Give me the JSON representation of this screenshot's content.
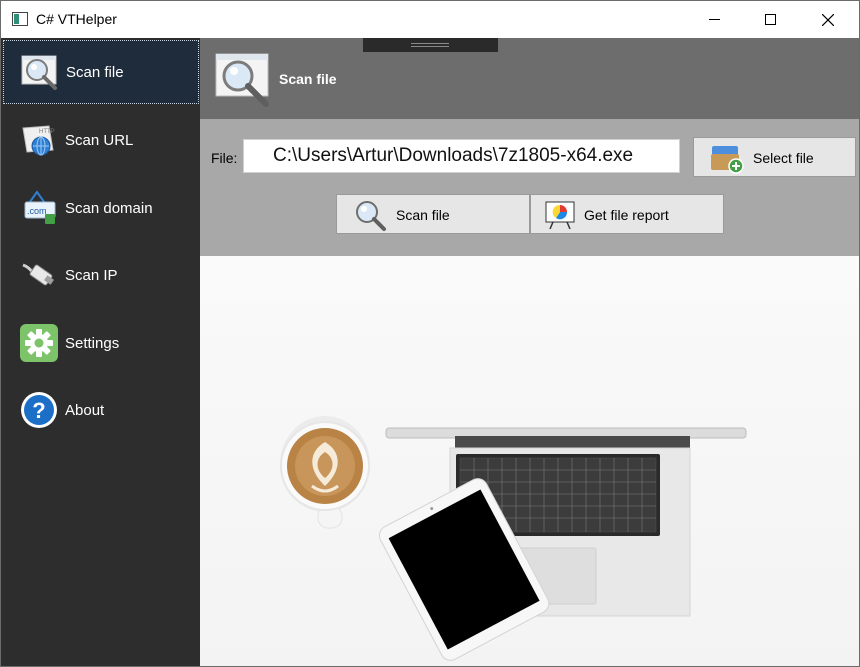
{
  "window": {
    "title": "C# VTHelper"
  },
  "sidebar": {
    "items": [
      {
        "label": "Scan file",
        "icon": "magnifier-icon",
        "active": true
      },
      {
        "label": "Scan URL",
        "icon": "globe-url-icon",
        "active": false
      },
      {
        "label": "Scan domain",
        "icon": "domain-icon",
        "active": false
      },
      {
        "label": "Scan IP",
        "icon": "network-plug-icon",
        "active": false
      },
      {
        "label": "Settings",
        "icon": "gear-icon",
        "active": false
      },
      {
        "label": "About",
        "icon": "help-icon",
        "active": false
      }
    ]
  },
  "header": {
    "title": "Scan file"
  },
  "panel": {
    "file_label": "File:",
    "file_path": "C:\\Users\\Artur\\Downloads\\7z1805-x64.exe",
    "select_button": "Select file",
    "scan_button": "Scan file",
    "report_button": "Get file report"
  },
  "colors": {
    "sidebar_bg": "#2d2d2d",
    "active_item_bg": "#1f2c3c",
    "header_bg": "#6d6d6d",
    "panel_bg": "#a8a8a8",
    "button_bg": "#e6e6e6"
  }
}
